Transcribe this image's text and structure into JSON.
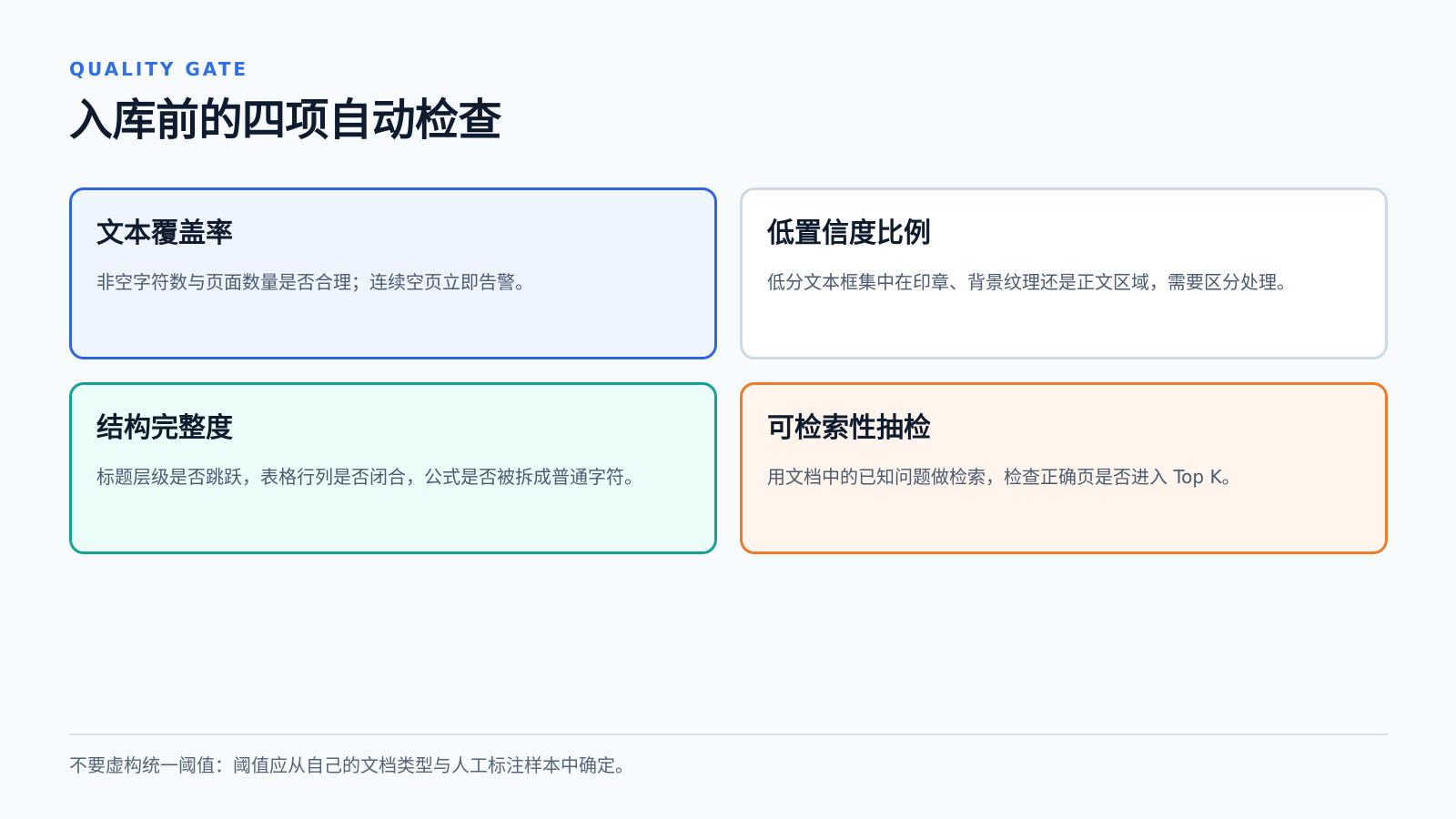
{
  "header": {
    "eyebrow": "QUALITY GATE",
    "title": "入库前的四项自动检查"
  },
  "cards": [
    {
      "title": "文本覆盖率",
      "description": "非空字符数与页面数量是否合理；连续空页立即告警。",
      "accent": "#2f66dd",
      "background": "#eef5ff"
    },
    {
      "title": "低置信度比例",
      "description": "低分文本框集中在印章、背景纹理还是正文区域，需要区分处理。",
      "accent": "#cdd9e5",
      "background": "#ffffff"
    },
    {
      "title": "结构完整度",
      "description": "标题层级是否跳跃，表格行列是否闭合，公式是否被拆成普通字符。",
      "accent": "#16a096",
      "background": "#ebfdf8"
    },
    {
      "title": "可检索性抽检",
      "description": "用文档中的已知问题做检索，检查正确页是否进入 Top K。",
      "accent": "#f0792a",
      "background": "#fff5ec"
    }
  ],
  "footer": {
    "note": "不要虚构统一阈值：阈值应从自己的文档类型与人工标注样本中确定。"
  },
  "colors": {
    "eyebrow": "#2f6fe0",
    "title": "#0f1b2e",
    "body_text": "#4a5a70",
    "page_background": "#f8fbfe"
  }
}
